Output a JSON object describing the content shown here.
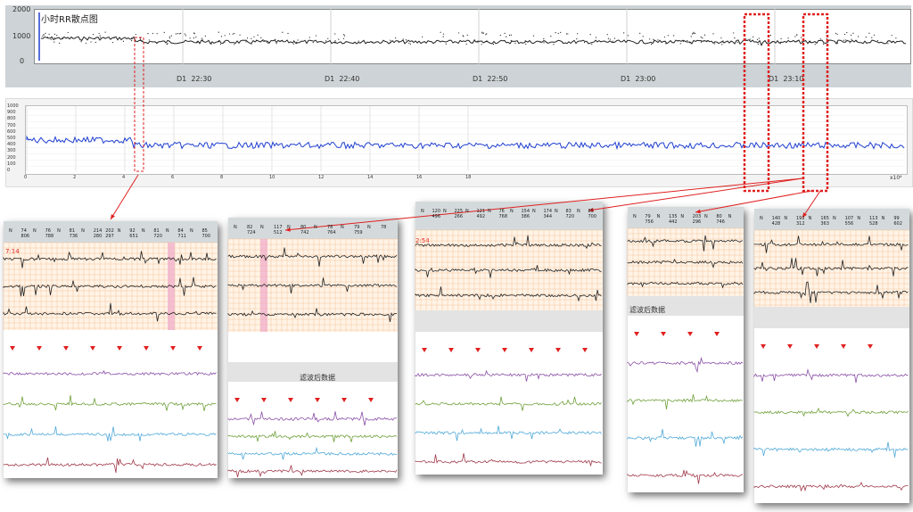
{
  "top_panel": {
    "title": "小时RR散点图",
    "y_ticks": [
      "2000",
      "1000",
      "0"
    ],
    "x_ticks": [
      {
        "day": "D1",
        "time": "22:30"
      },
      {
        "day": "D1",
        "time": "22:40"
      },
      {
        "day": "D1",
        "time": "22:50"
      },
      {
        "day": "D1",
        "time": "23:00"
      },
      {
        "day": "D1",
        "time": "23:10"
      }
    ]
  },
  "mid_panel": {
    "y_ticks": [
      "1000",
      "900",
      "800",
      "700",
      "600",
      "500",
      "400",
      "300",
      "200",
      "100",
      "0"
    ],
    "x_ticks": [
      "0",
      "2",
      "4",
      "6",
      "8",
      "10",
      "12",
      "14",
      "16",
      "18"
    ],
    "x_exponent": "x10⁴"
  },
  "filtered_label": "滤波后数据",
  "snapshots": [
    {
      "timestamp": "7:14",
      "beats": [
        [
          "N",
          ""
        ],
        [
          "74",
          "806"
        ],
        [
          "N",
          ""
        ],
        [
          "76",
          "788"
        ],
        [
          "N",
          ""
        ],
        [
          "81",
          "736"
        ],
        [
          "N",
          ""
        ],
        [
          "214",
          "280"
        ],
        [
          "202",
          "297"
        ],
        [
          "N",
          ""
        ],
        [
          "92",
          "651"
        ],
        [
          "N",
          ""
        ],
        [
          "81",
          "720"
        ],
        [
          "N",
          ""
        ],
        [
          "84",
          "711"
        ],
        [
          "N",
          ""
        ],
        [
          "85",
          "700"
        ]
      ]
    },
    {
      "timestamp": "",
      "beats": [
        [
          "N",
          ""
        ],
        [
          "82",
          "724"
        ],
        [
          "N",
          ""
        ],
        [
          "117",
          "512"
        ],
        [
          "N",
          ""
        ],
        [
          "80",
          "742"
        ],
        [
          "N",
          ""
        ],
        [
          "78",
          "764"
        ],
        [
          "N",
          ""
        ],
        [
          "79",
          "759"
        ],
        [
          "N",
          ""
        ],
        [
          "78",
          ""
        ]
      ]
    },
    {
      "timestamp": "2:54",
      "beats": [
        [
          "N",
          ""
        ],
        [
          "120",
          "496"
        ],
        [
          "N",
          ""
        ],
        [
          "225",
          "266"
        ],
        [
          "N",
          ""
        ],
        [
          "121",
          "492"
        ],
        [
          "N",
          ""
        ],
        [
          "76",
          "768"
        ],
        [
          "N",
          ""
        ],
        [
          "154",
          "386"
        ],
        [
          "N",
          ""
        ],
        [
          "174",
          "344"
        ],
        [
          "N",
          ""
        ],
        [
          "83",
          "720"
        ],
        [
          "N",
          ""
        ],
        [
          "85",
          "700"
        ]
      ]
    },
    {
      "timestamp": "",
      "beats": [
        [
          "N",
          ""
        ],
        [
          "79",
          "756"
        ],
        [
          "N",
          ""
        ],
        [
          "135",
          "442"
        ],
        [
          "N",
          ""
        ],
        [
          "203",
          "296"
        ],
        [
          "N",
          ""
        ],
        [
          "80",
          "746"
        ],
        [
          "N",
          ""
        ]
      ]
    },
    {
      "timestamp": "",
      "beats": [
        [
          "N",
          ""
        ],
        [
          "140",
          "428"
        ],
        [
          "N",
          ""
        ],
        [
          "192",
          "312"
        ],
        [
          "N",
          ""
        ],
        [
          "165",
          "363"
        ],
        [
          "N",
          ""
        ],
        [
          "107",
          "556"
        ],
        [
          "N",
          ""
        ],
        [
          "113",
          "528"
        ],
        [
          "N",
          ""
        ],
        [
          "99",
          "602"
        ]
      ]
    }
  ],
  "colors": {
    "top_trace": "#222222",
    "mid_trace": "#1f3fd0",
    "ecg": "#222222",
    "ecg_bg": "#fff3e6",
    "grid": "#f4b98a",
    "callout": "#e02020",
    "lead1": "#8a4fa6",
    "lead2": "#6fa03a",
    "lead3": "#4fa8d8",
    "lead4": "#a03a4a",
    "highlight": "#f0a8c8",
    "marker": "#e02020"
  },
  "icons": {
    "beat_marker": "red-down-triangle-icon"
  }
}
